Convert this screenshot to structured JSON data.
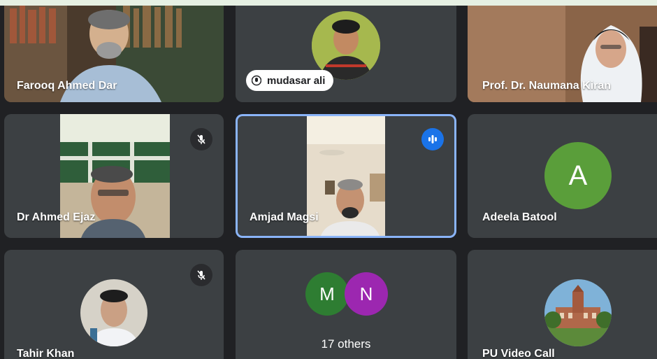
{
  "participants": [
    {
      "name": "Farooq Ahmed Dar",
      "muted": false
    },
    {
      "name": "mudasar ali",
      "muted": false
    },
    {
      "name": "Prof. Dr. Naumana Kiran",
      "muted": false
    },
    {
      "name": "Dr Ahmed Ejaz",
      "muted": true
    },
    {
      "name": "Amjad Magsi",
      "muted": false,
      "speaking": true
    },
    {
      "name": "Adeela Batool",
      "muted": false,
      "avatar_letter": "A",
      "avatar_color": "#5a9e3a"
    },
    {
      "name": "Tahir Khan",
      "muted": true
    },
    {
      "name": "PU Video Call",
      "muted": false
    }
  ],
  "others": {
    "label": "17 others",
    "avatars": [
      {
        "letter": "M",
        "color": "#2e7d32"
      },
      {
        "letter": "N",
        "color": "#9c27b0"
      }
    ]
  },
  "colors": {
    "background": "#202124",
    "tile": "#3c4043",
    "speaking_border": "#8ab4f8",
    "speaking_badge": "#1a73e8"
  }
}
